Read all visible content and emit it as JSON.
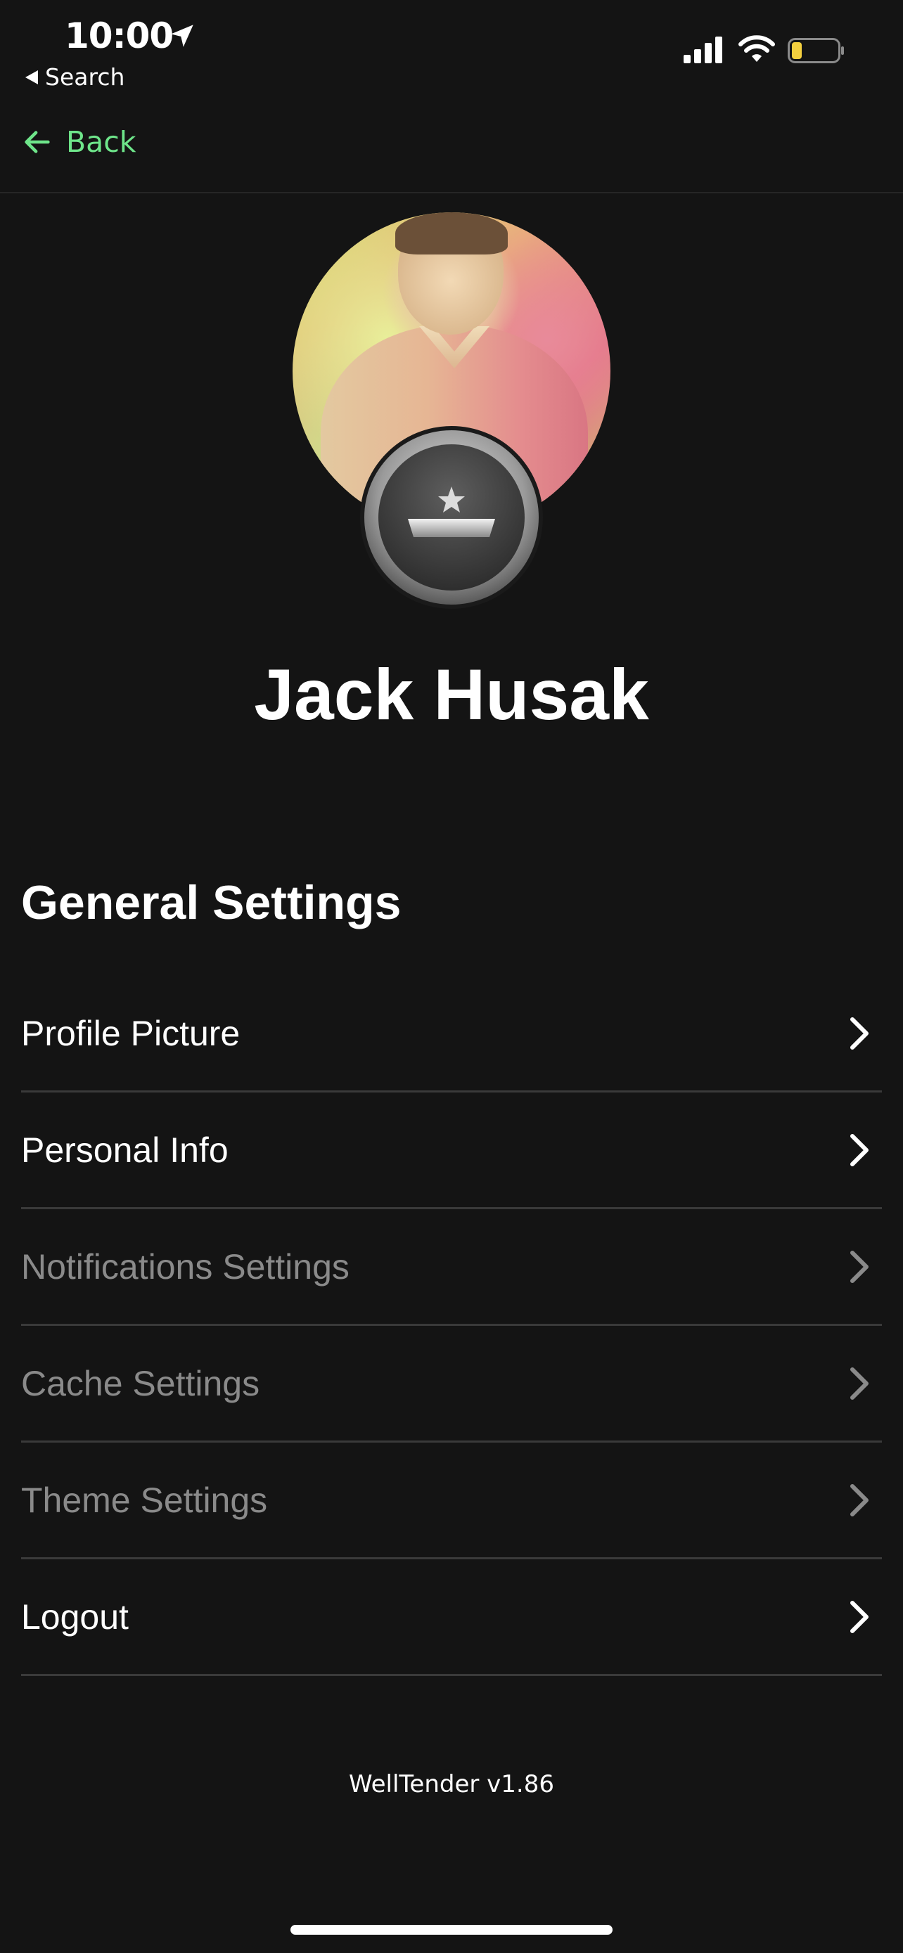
{
  "status_bar": {
    "time": "10:00",
    "back_app_label": "Search",
    "battery_color": "#f4d03f"
  },
  "nav": {
    "back_label": "Back",
    "accent_color": "#6ee58a"
  },
  "profile": {
    "name": "Jack Husak",
    "avatar_icon": "profile-photo",
    "badge_icon": "rank-badge-icon"
  },
  "settings": {
    "section_title": "General Settings",
    "items": [
      {
        "label": "Profile Picture",
        "enabled": true
      },
      {
        "label": "Personal Info",
        "enabled": true
      },
      {
        "label": "Notifications Settings",
        "enabled": false
      },
      {
        "label": "Cache Settings",
        "enabled": false
      },
      {
        "label": "Theme Settings",
        "enabled": false
      },
      {
        "label": "Logout",
        "enabled": true
      }
    ]
  },
  "footer": {
    "version": "WellTender v1.86"
  }
}
